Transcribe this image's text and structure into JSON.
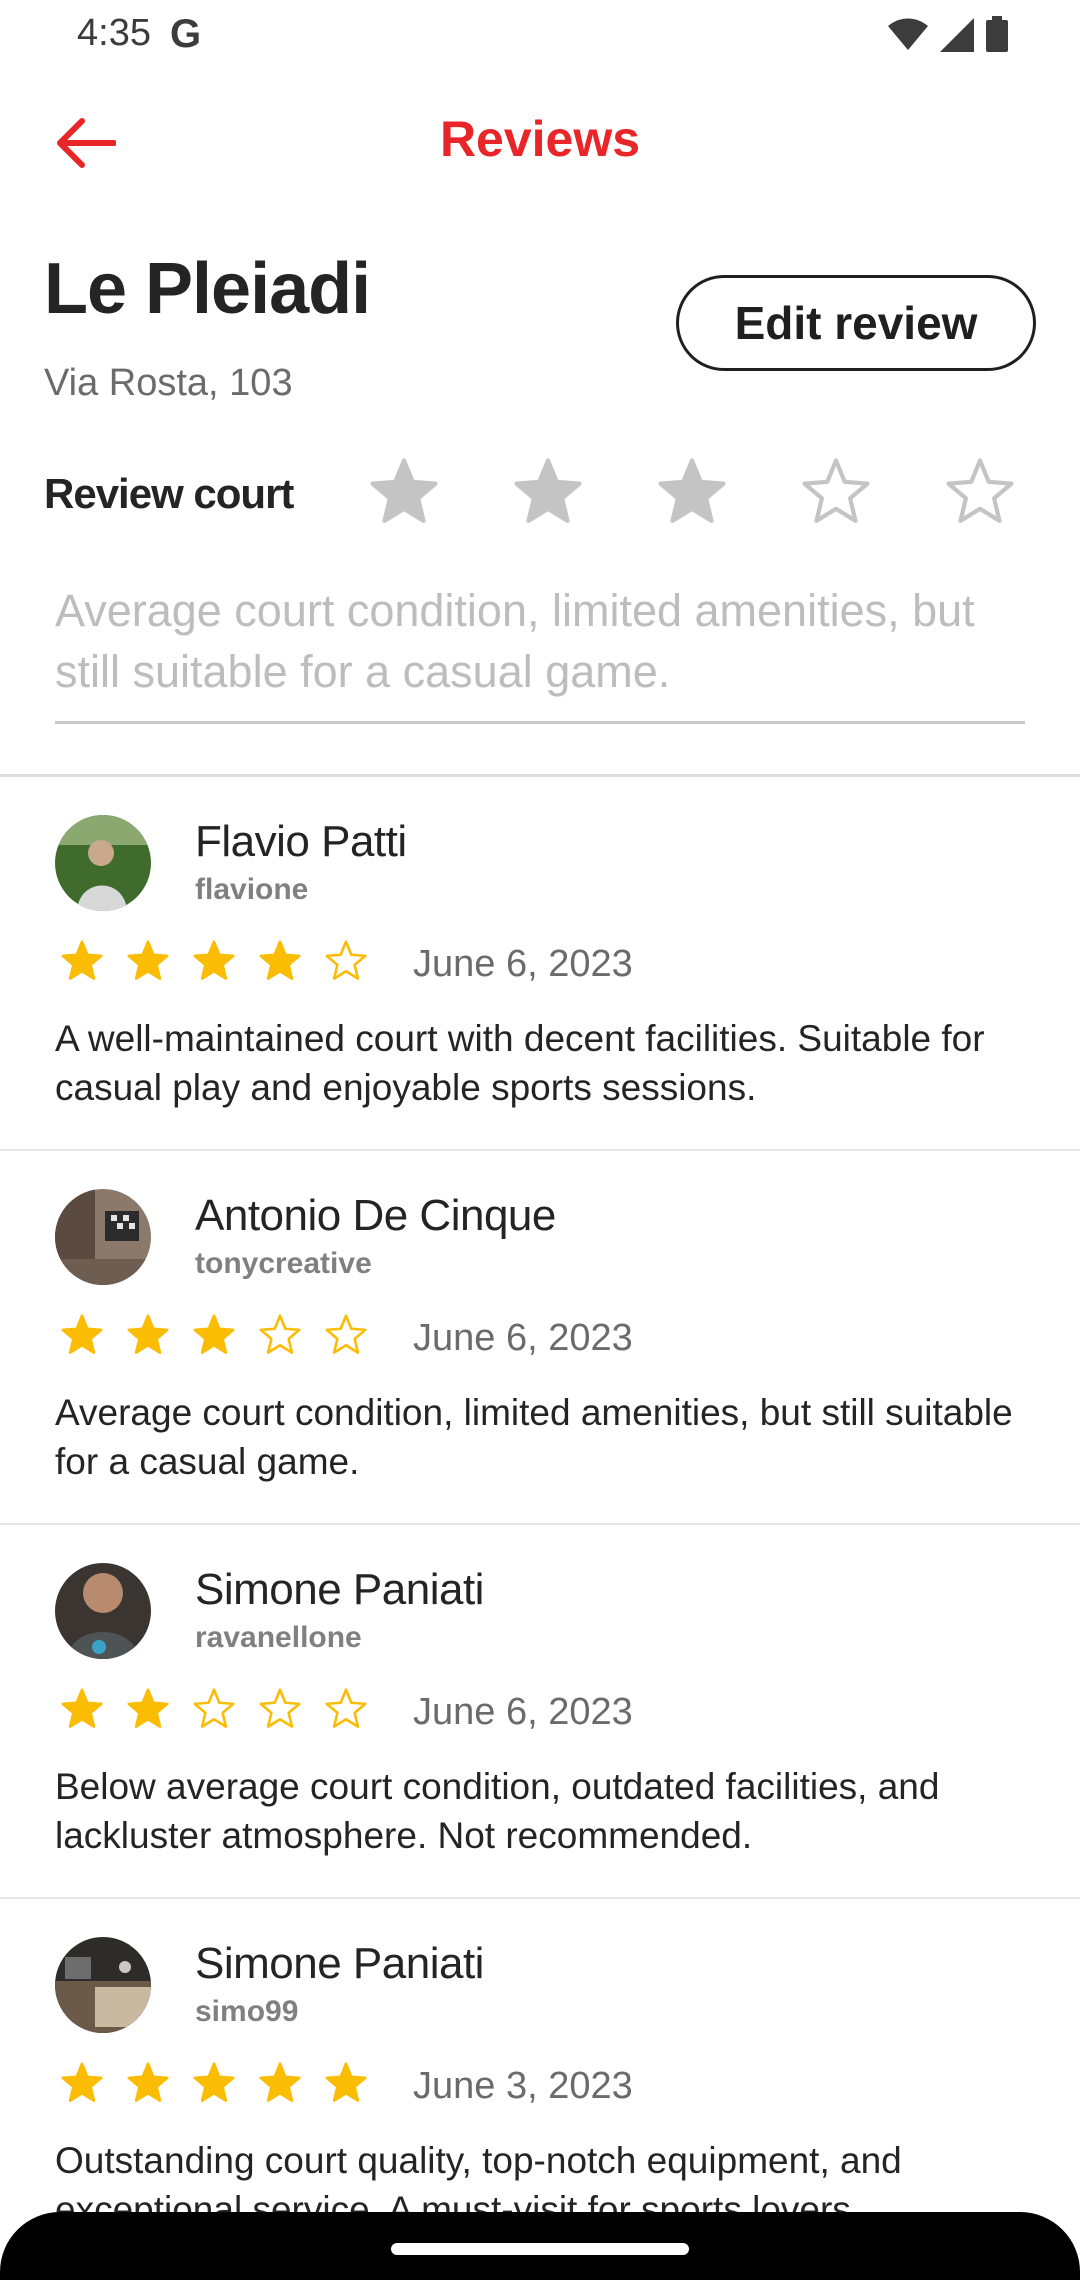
{
  "status_bar": {
    "time": "4:35",
    "google_glyph": "G",
    "icons": [
      "wifi-icon",
      "signal-icon",
      "battery-icon"
    ]
  },
  "app_bar": {
    "title": "Reviews",
    "back_icon": "arrow-left-icon",
    "accent_color": "#e8262a"
  },
  "court": {
    "name": "Le Pleiadi",
    "address": "Via Rosta, 103",
    "edit_button_label": "Edit review",
    "review_label": "Review court",
    "user_rating": 3,
    "max_rating": 5,
    "review_input_placeholder": "Average court condition, limited amenities, but still suitable for a casual game."
  },
  "reviews": [
    {
      "name": "Flavio Patti",
      "handle": "flavione",
      "rating": 4,
      "date": "June 6, 2023",
      "text": "A well-maintained court with decent facilities. Suitable for casual play and enjoyable sports sessions."
    },
    {
      "name": "Antonio De Cinque",
      "handle": "tonycreative",
      "rating": 3,
      "date": "June 6, 2023",
      "text": "Average court condition, limited amenities, but still suitable for a casual game."
    },
    {
      "name": "Simone Paniati",
      "handle": "ravanellone",
      "rating": 2,
      "date": "June 6, 2023",
      "text": "Below average court condition, outdated facilities, and lackluster atmosphere. Not recommended."
    },
    {
      "name": "Simone Paniati",
      "handle": "simo99",
      "rating": 5,
      "date": "June 3, 2023",
      "text": "Outstanding court quality, top-notch equipment, and exceptional service. A must-visit for sports lovers."
    }
  ],
  "colors": {
    "star_filled": "#fbbc04",
    "court_star_filled": "#c4c4c4",
    "court_star_empty": "#c4c4c4"
  }
}
